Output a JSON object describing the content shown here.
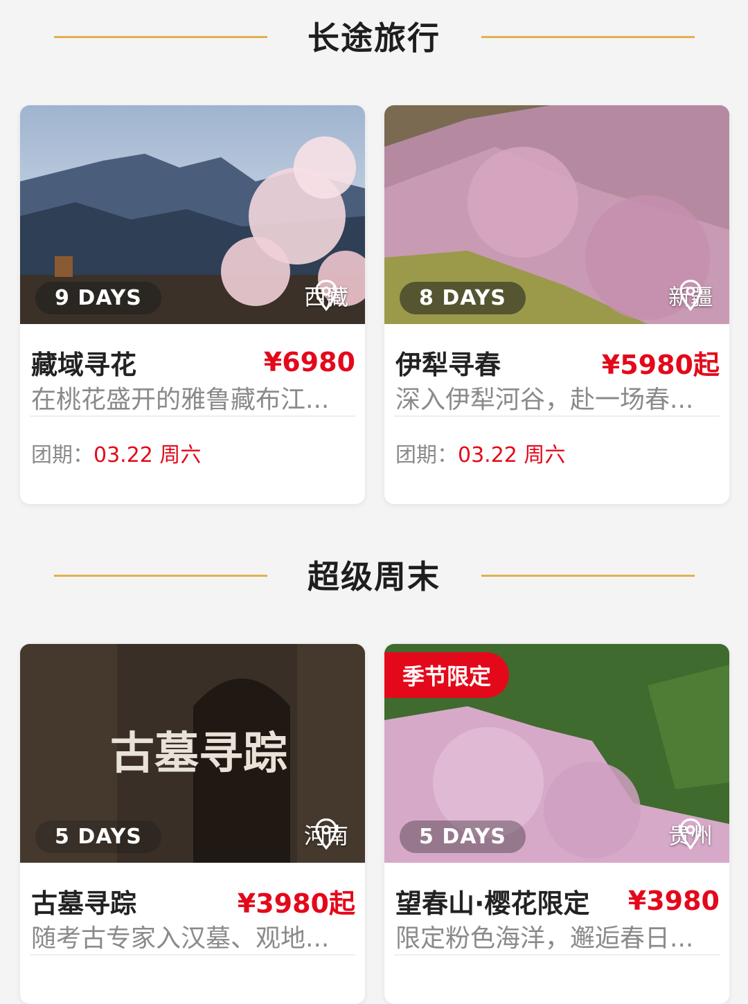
{
  "sections": [
    {
      "title": "长途旅行"
    },
    {
      "title": "超级周末"
    }
  ],
  "cards": [
    {
      "days": "9 DAYS",
      "location": "西藏",
      "title": "藏域寻花",
      "price": "¥6980",
      "desc": "在桃花盛开的雅鲁藏布江...",
      "date_label": "团期：",
      "date_value": "03.22 周六"
    },
    {
      "days": "8 DAYS",
      "location": "新疆",
      "title": "伊犁寻春",
      "price": "¥5980起",
      "desc": "深入伊犁河谷，赴一场春...",
      "date_label": "团期：",
      "date_value": "03.22 周六"
    },
    {
      "days": "5 DAYS",
      "location": "河南",
      "title": "古墓寻踪",
      "price": "¥3980起",
      "desc": "随考古专家入汉墓、观地...",
      "image_text": "古墓寻踪"
    },
    {
      "days": "5 DAYS",
      "location": "贵州",
      "title": "望春山·樱花限定",
      "price": "¥3980",
      "desc": "限定粉色海洋，邂逅春日...",
      "tag": "季节限定"
    }
  ],
  "icons": {
    "location": "map-pin-icon"
  },
  "colors": {
    "accent": "#e3091b",
    "divider": "#e2b14a"
  }
}
